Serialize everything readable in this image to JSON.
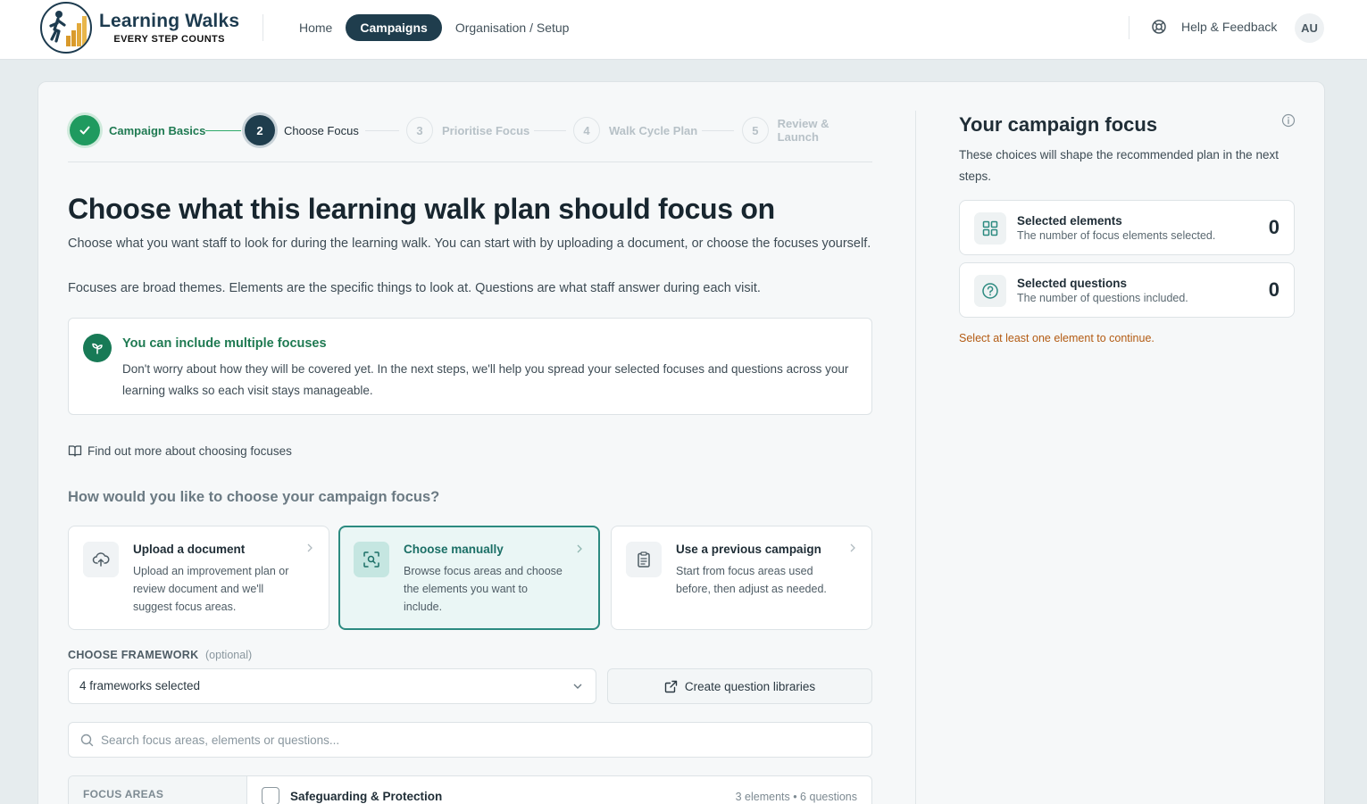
{
  "app": {
    "logo_title": "Learning Walks",
    "logo_tagline": "EVERY STEP COUNTS"
  },
  "nav": {
    "items": [
      {
        "label": "Home",
        "active": false
      },
      {
        "label": "Campaigns",
        "active": true
      },
      {
        "label": "Organisation / Setup",
        "active": false
      }
    ],
    "help_label": "Help & Feedback",
    "avatar_initials": "AU"
  },
  "stepper": {
    "steps": [
      {
        "number": "",
        "label": "Campaign Basics",
        "state": "complete"
      },
      {
        "number": "2",
        "label": "Choose Focus",
        "state": "current"
      },
      {
        "number": "3",
        "label": "Prioritise Focus",
        "state": "upcoming"
      },
      {
        "number": "4",
        "label": "Walk Cycle Plan",
        "state": "upcoming"
      },
      {
        "number": "5",
        "label": "Review & Launch",
        "state": "upcoming"
      }
    ]
  },
  "main": {
    "heading": "Choose what this learning walk plan should focus on",
    "intro_1": "Choose what you want staff to look for during the learning walk. You can start with by uploading a document, or choose the focuses yourself.",
    "intro_2": "Focuses are broad themes. Elements are the specific things to look at. Questions are what staff answer during each visit.",
    "info_box": {
      "title": "You can include multiple focuses",
      "text": "Don't worry about how they will be covered yet. In the next steps, we'll help you spread your selected focuses and questions across your learning walks so each visit stays manageable.",
      "icon": "sprout-icon"
    },
    "find_more_link": "Find out more about choosing focuses",
    "choose_question": "How would you like to choose your campaign focus?",
    "options": [
      {
        "title": "Upload a document",
        "desc": "Upload an improvement plan or review document and we'll suggest focus areas.",
        "icon": "cloud-upload-icon",
        "selected": false
      },
      {
        "title": "Choose manually",
        "desc": "Browse focus areas and choose the elements you want to include.",
        "icon": "scan-search-icon",
        "selected": true
      },
      {
        "title": "Use a previous campaign",
        "desc": "Start from focus areas used before, then adjust as needed.",
        "icon": "clipboard-icon",
        "selected": false
      }
    ],
    "framework": {
      "label": "CHOOSE FRAMEWORK",
      "optional": "(optional)",
      "selected_value": "4 frameworks selected",
      "question_libraries_button": "Create question libraries"
    },
    "search": {
      "placeholder": "Search focus areas, elements or questions..."
    },
    "focus_areas": {
      "side_label": "FOCUS AREAS",
      "rows": [
        {
          "title": "Safeguarding & Protection",
          "meta": "3 elements • 6 questions",
          "checked": false
        }
      ]
    }
  },
  "summary": {
    "title": "Your campaign focus",
    "subtitle": "These choices will shape the recommended plan in the next steps.",
    "stats": [
      {
        "title": "Selected elements",
        "desc": "The number of focus elements selected.",
        "value": "0",
        "icon": "grid-icon"
      },
      {
        "title": "Selected questions",
        "desc": "The number of questions included.",
        "value": "0",
        "icon": "question-circle-icon"
      }
    ],
    "warning": "Select at least one element to continue."
  },
  "colors": {
    "brand_dark": "#1f3d4d",
    "success_green": "#1f9a5f",
    "accent_teal": "#2c8a80",
    "warning_orange": "#b35b13"
  }
}
